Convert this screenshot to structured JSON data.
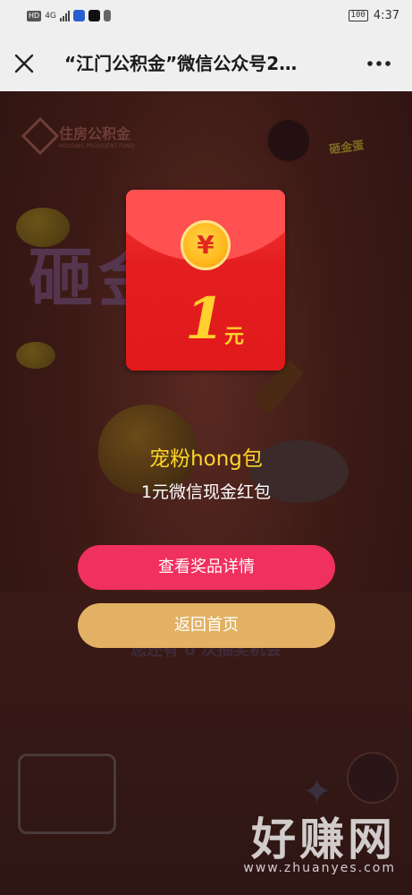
{
  "status_bar": {
    "network_badge": "HD",
    "network_type": "4G",
    "battery": "100",
    "time": "4:37"
  },
  "nav": {
    "title": "“江门公积金”微信公众号2…",
    "close_icon": "close-icon",
    "more_icon": "more-icon"
  },
  "background": {
    "logo_text": "住房公积金",
    "logo_subtext": "HOUSING PROVIDENT FUND",
    "banner_text": "砸金蛋",
    "corner_tag": "砸金蛋",
    "chances_text": "您还有 0 次抽奖机会"
  },
  "prize": {
    "coin_symbol": "¥",
    "amount": "1",
    "amount_unit": "元",
    "name": "宠粉hong包",
    "description": "1元微信现金红包",
    "colors": {
      "envelope": "#e51f1f",
      "coin": "#ffb81c",
      "name_text": "#ffd52a"
    }
  },
  "buttons": {
    "detail_label": "查看奖品详情",
    "home_label": "返回首页",
    "detail_color": "#f0305e",
    "home_color": "#e2b163"
  },
  "watermark": {
    "main": "好赚网",
    "url": "www.zhuanyes.com"
  }
}
